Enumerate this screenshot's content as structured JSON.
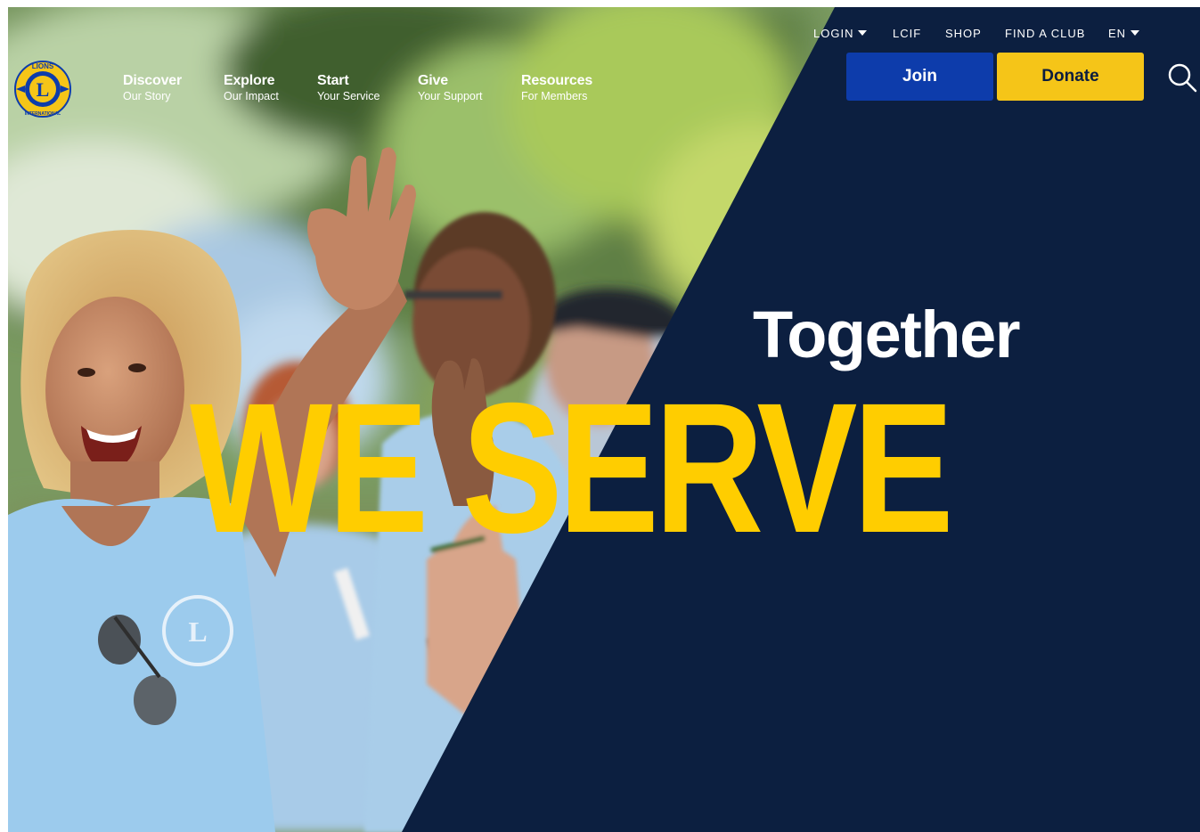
{
  "header": {
    "logo_text": "LIONS INTERNATIONAL",
    "main_nav": [
      {
        "title": "Discover",
        "subtitle": "Our Story"
      },
      {
        "title": "Explore",
        "subtitle": "Our Impact"
      },
      {
        "title": "Start",
        "subtitle": "Your Service"
      },
      {
        "title": "Give",
        "subtitle": "Your Support"
      },
      {
        "title": "Resources",
        "subtitle": "For Members"
      }
    ],
    "utility_nav": {
      "login": "LOGIN",
      "lcif": "LCIF",
      "shop": "SHOP",
      "find_club": "FIND A CLUB",
      "language": "EN"
    },
    "join_label": "Join",
    "donate_label": "Donate",
    "search_icon": "search-icon"
  },
  "hero": {
    "tagline_small": "Together",
    "tagline_large": "WE SERVE"
  },
  "colors": {
    "navy": "#0c1f40",
    "join_blue": "#0d3cab",
    "donate_yellow": "#f5c518",
    "headline_yellow": "#ffcd00",
    "white": "#ffffff"
  }
}
